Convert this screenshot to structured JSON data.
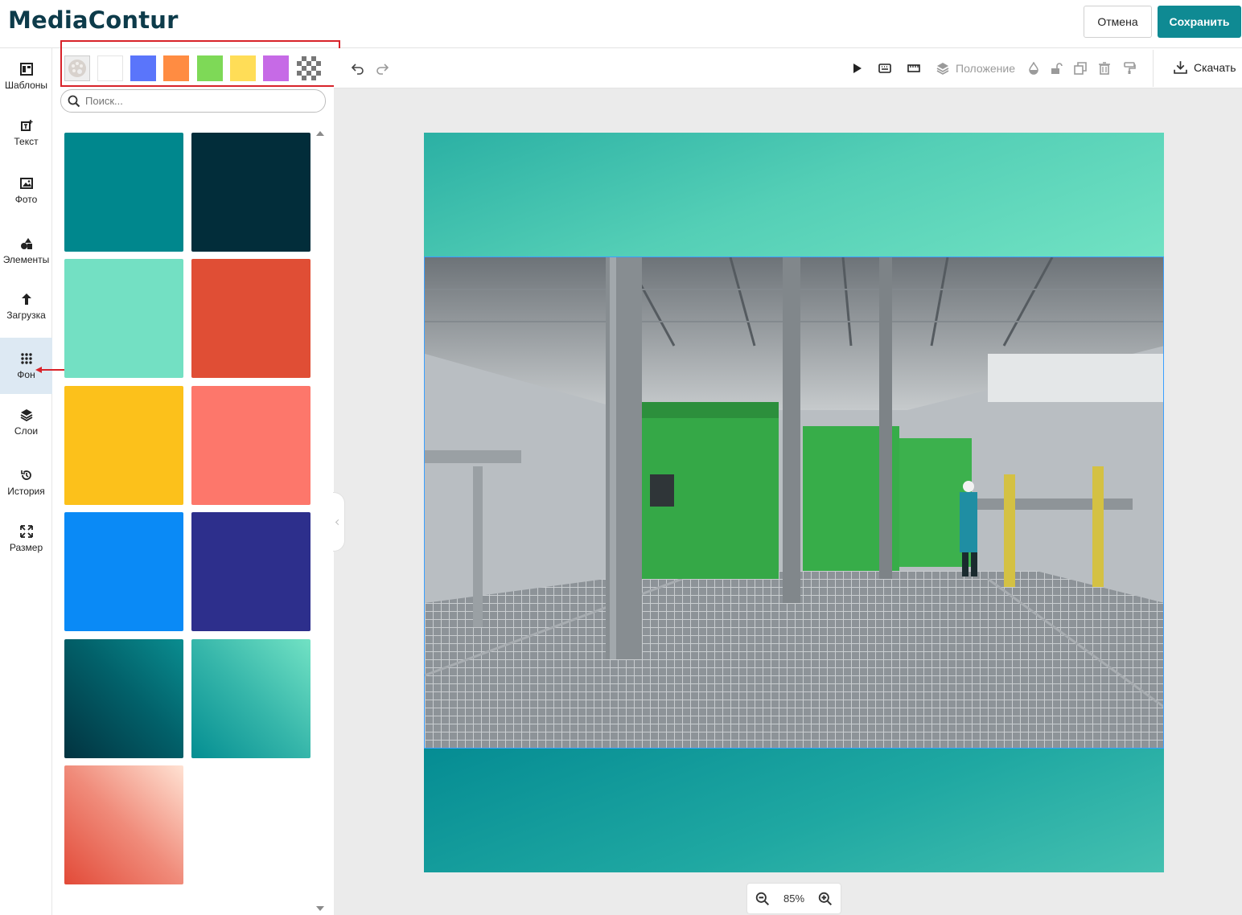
{
  "app": {
    "logo": "MediaContur",
    "cancel_label": "Отмена",
    "save_label": "Сохранить"
  },
  "sidebar": {
    "items": [
      {
        "label": "Шаблоны",
        "icon": "templates-icon"
      },
      {
        "label": "Текст",
        "icon": "text-icon"
      },
      {
        "label": "Фото",
        "icon": "photo-icon"
      },
      {
        "label": "Элементы",
        "icon": "elements-icon"
      },
      {
        "label": "Загрузка",
        "icon": "upload-icon"
      },
      {
        "label": "Фон",
        "icon": "background-icon",
        "active": true
      },
      {
        "label": "Слои",
        "icon": "layers-icon"
      },
      {
        "label": "История",
        "icon": "history-icon"
      },
      {
        "label": "Размер",
        "icon": "resize-icon"
      }
    ]
  },
  "panel": {
    "quick_colors": [
      "palette",
      "#ffffff",
      "#5a75fb",
      "#ff8c42",
      "#7ed957",
      "#ffdd57",
      "#c66ae6",
      "transparent"
    ],
    "search_placeholder": "Поиск...",
    "backgrounds": [
      "#00878d",
      "#022d3a",
      "#73e0c3",
      "#e04e35",
      "#fcc11b",
      "#fd776b",
      "#0a8af6",
      "#2d2f8c",
      "gradient-deep-teal",
      "gradient-teal-mint",
      "gradient-coral-peach"
    ]
  },
  "toolbar": {
    "position_label": "Положение",
    "download_label": "Скачать"
  },
  "zoom": {
    "value": "85%"
  },
  "colors": {
    "accent": "#0f8a93",
    "highlight": "#d8232a",
    "selection": "#3aa0ff"
  }
}
